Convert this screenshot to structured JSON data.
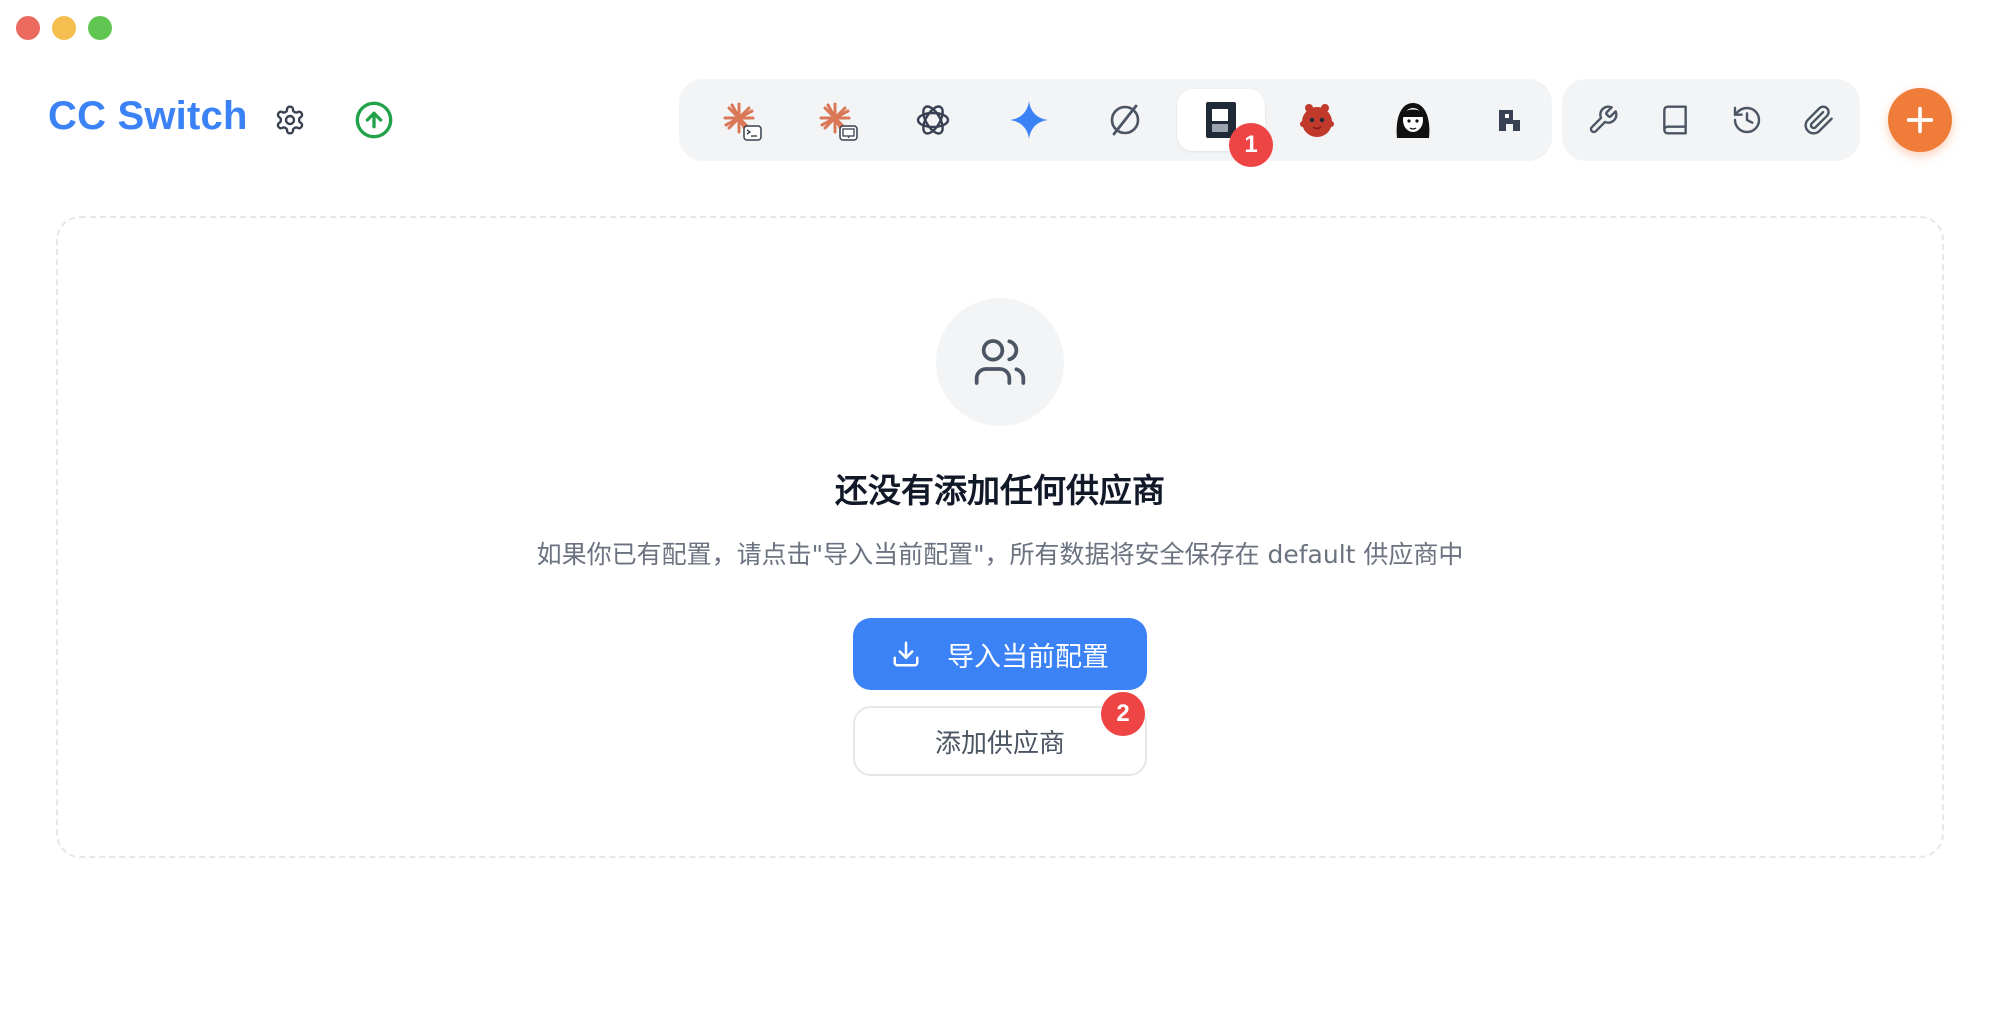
{
  "window": {
    "controls": [
      "close",
      "minimize",
      "maximize"
    ]
  },
  "header": {
    "title": "CC Switch",
    "settings_icon": "gear-icon",
    "update_icon": "arrow-up-circle-icon"
  },
  "app_tabs": [
    {
      "icon": "claude-code-icon",
      "active": false
    },
    {
      "icon": "claude-desktop-icon",
      "active": false
    },
    {
      "icon": "openai-icon",
      "active": false
    },
    {
      "icon": "gemini-icon",
      "active": false
    },
    {
      "icon": "opencode-icon",
      "active": false
    },
    {
      "icon": "terminal-app-icon",
      "active": true
    },
    {
      "icon": "red-mascot-icon",
      "active": false
    },
    {
      "icon": "avatar-girl-icon",
      "active": false
    },
    {
      "icon": "pixel-logo-icon",
      "active": false
    }
  ],
  "tools": [
    {
      "icon": "wrench-icon"
    },
    {
      "icon": "book-icon"
    },
    {
      "icon": "history-icon"
    },
    {
      "icon": "paperclip-icon"
    }
  ],
  "add_button_icon": "plus-icon",
  "badges": {
    "first": "1",
    "second": "2"
  },
  "empty_state": {
    "icon": "users-icon",
    "title": "还没有添加任何供应商",
    "description": "如果你已有配置，请点击\"导入当前配置\"，所有数据将安全保存在 default 供应商中",
    "import_label": "导入当前配置",
    "add_label": "添加供应商"
  },
  "colors": {
    "accent_blue": "#3b82f6",
    "accent_orange": "#f07c3a",
    "badge_red": "#ef4444",
    "update_green": "#22a34a"
  }
}
